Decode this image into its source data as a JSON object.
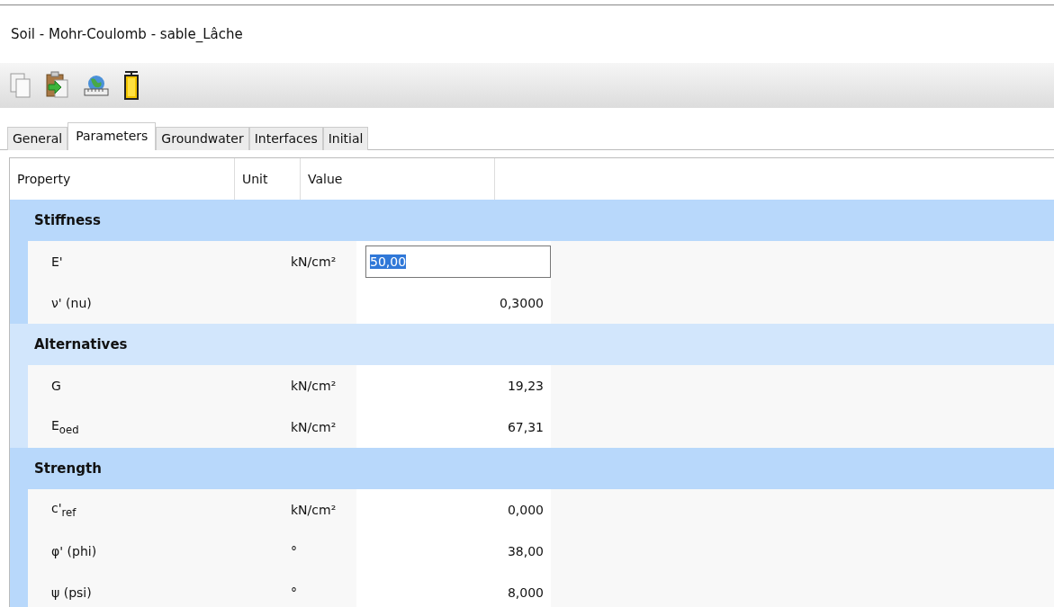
{
  "window": {
    "title": "Soil - Mohr-Coulomb - sable_Lâche"
  },
  "tabs": [
    {
      "label": "General",
      "selected": false
    },
    {
      "label": "Parameters",
      "selected": true
    },
    {
      "label": "Groundwater",
      "selected": false
    },
    {
      "label": "Interfaces",
      "selected": false
    },
    {
      "label": "Initial",
      "selected": false
    }
  ],
  "table": {
    "columns": [
      "Property",
      "Unit",
      "Value"
    ],
    "groups": [
      {
        "title": "Stiffness",
        "color": "#b8d8fb",
        "rows": [
          {
            "property": "E'",
            "unit": "kN/cm²",
            "value": "50,00",
            "kind": "editing"
          },
          {
            "property": "ν' (nu)",
            "value": "0,3000",
            "kind": "plain"
          }
        ]
      },
      {
        "title": "Alternatives",
        "color": "#d2e6fc",
        "rows": [
          {
            "property": "G",
            "unit": "kN/cm²",
            "value": "19,23",
            "kind": "plain"
          },
          {
            "property": "E$_{oed}$",
            "unit": "kN/cm²",
            "value": "67,31",
            "kind": "plain"
          }
        ]
      },
      {
        "title": "Strength",
        "color": "#b8d8fb",
        "rows": [
          {
            "property": "c'$_{ref}$",
            "unit": "kN/cm²",
            "value": "0,000",
            "kind": "plain"
          },
          {
            "property": "φ' (phi)",
            "unit": "°",
            "value": "38,00",
            "kind": "plain"
          },
          {
            "property": "ψ (psi)",
            "unit": "°",
            "value": "8,000",
            "kind": "plain"
          }
        ]
      }
    ]
  }
}
